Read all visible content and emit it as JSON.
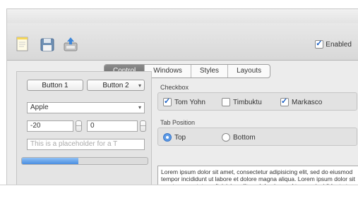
{
  "toolbar": {
    "icons": [
      "new-document-icon",
      "save-icon",
      "export-icon"
    ],
    "enabled_label": "Enabled",
    "enabled_checked": true
  },
  "tabs": [
    {
      "label": "Control",
      "active": true
    },
    {
      "label": "Windows",
      "active": false
    },
    {
      "label": "Styles",
      "active": false
    },
    {
      "label": "Layouts",
      "active": false
    }
  ],
  "left": {
    "button1": "Button 1",
    "button2": "Button 2",
    "popup_value": "Apple",
    "number1": "-20",
    "number2": "0",
    "placeholder": "This is a placeholder for a T",
    "progress": 0.45
  },
  "checkbox_group": {
    "label": "Checkbox",
    "items": [
      {
        "label": "Tom Yohn",
        "checked": true
      },
      {
        "label": "Timbuktu",
        "checked": false
      },
      {
        "label": "Markasco",
        "checked": true
      }
    ]
  },
  "radio_group": {
    "label": "Tab Position",
    "items": [
      {
        "label": "Top",
        "selected": true
      },
      {
        "label": "Bottom",
        "selected": false
      }
    ]
  },
  "text_area": "Lorem ipsum dolor sit amet, consectetur adipisicing elit, sed do eiusmod tempor incididunt ut labore et dolore magna aliqua. Lorem ipsum dolor sit amet, consectetur adipisicing elit, sed do eiusmod tempor incididunt ut labore et dolore magna aliqua, consectetur adipisicing elit."
}
